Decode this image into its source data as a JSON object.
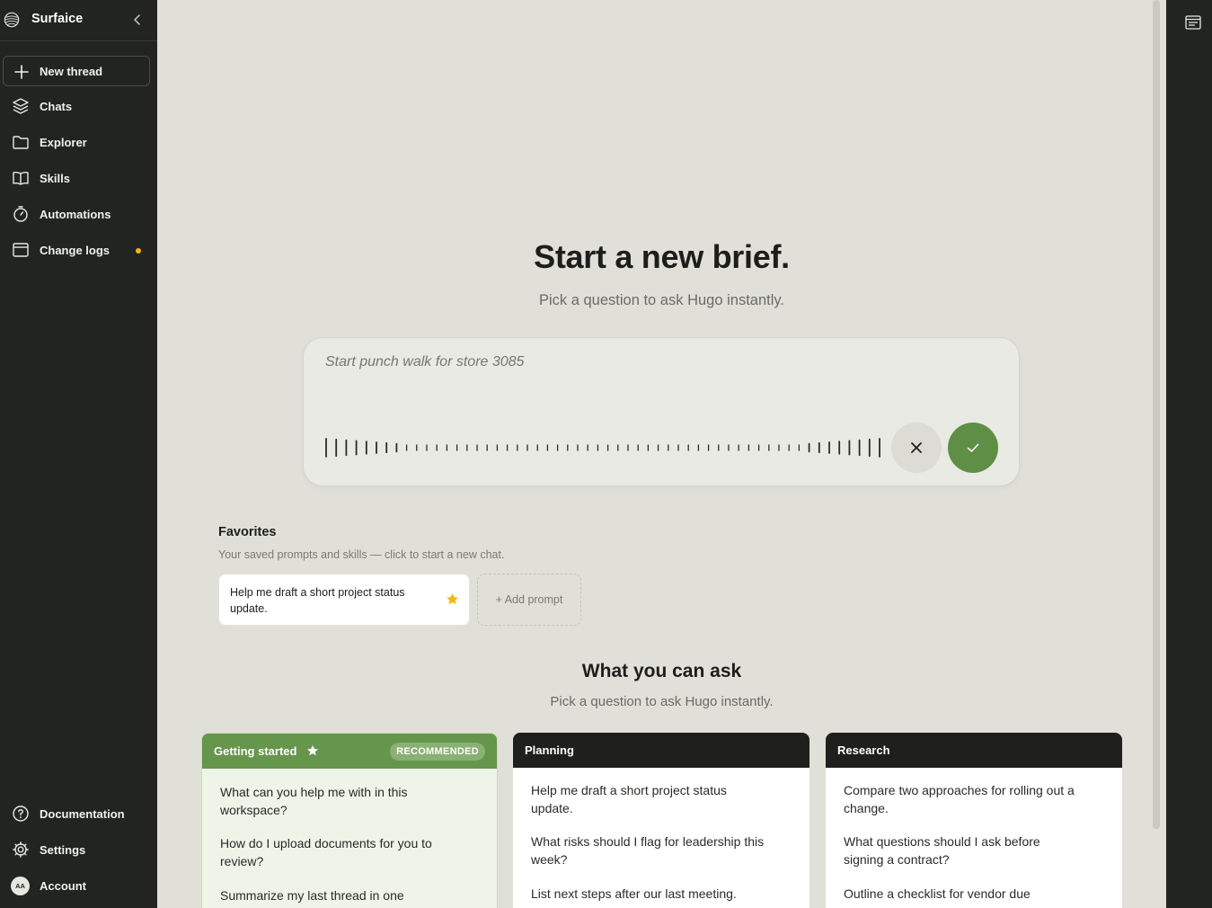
{
  "app": {
    "name": "Surfaice"
  },
  "sidebar": {
    "new_thread": "New thread",
    "items": [
      {
        "label": "Chats",
        "icon": "layers-icon"
      },
      {
        "label": "Explorer",
        "icon": "folder-icon"
      },
      {
        "label": "Skills",
        "icon": "book-icon"
      },
      {
        "label": "Automations",
        "icon": "timer-icon"
      },
      {
        "label": "Change logs",
        "icon": "layout-icon",
        "has_notification": true
      }
    ],
    "bottom": [
      {
        "label": "Documentation",
        "icon": "help-circle-icon"
      },
      {
        "label": "Settings",
        "icon": "gear-icon"
      },
      {
        "label": "Account",
        "icon": "avatar",
        "initials": "AA"
      }
    ]
  },
  "hero": {
    "title": "Start a new brief.",
    "subtitle": "Pick a question to ask Hugo instantly."
  },
  "composer": {
    "placeholder": "Start punch walk for store 3085",
    "state": "recording"
  },
  "favorites": {
    "title": "Favorites",
    "subtitle": "Your saved prompts and skills — click to start a new chat.",
    "items": [
      {
        "text": "Help me draft a short project status update.",
        "starred": true
      }
    ],
    "add_label": "+ Add prompt"
  },
  "ask": {
    "title": "What you can ask",
    "subtitle": "Pick a question to ask Hugo instantly."
  },
  "categories": [
    {
      "name": "Getting started",
      "badge": "RECOMMENDED",
      "questions": [
        "What can you help me with in this workspace?",
        "How do I upload documents for you to review?",
        "Summarize my last thread in one"
      ]
    },
    {
      "name": "Planning",
      "questions": [
        "Help me draft a short project status update.",
        "What risks should I flag for leadership this week?",
        "List next steps after our last meeting."
      ]
    },
    {
      "name": "Research",
      "questions": [
        "Compare two approaches for rolling out a change.",
        "What questions should I ask before signing a contract?",
        "Outline a checklist for vendor due"
      ]
    }
  ],
  "colors": {
    "sidebar_bg": "#222421",
    "main_bg": "#e0e0d9",
    "accent_green": "#5f8f47",
    "notification": "#f5b515",
    "star": "#f5b515"
  }
}
